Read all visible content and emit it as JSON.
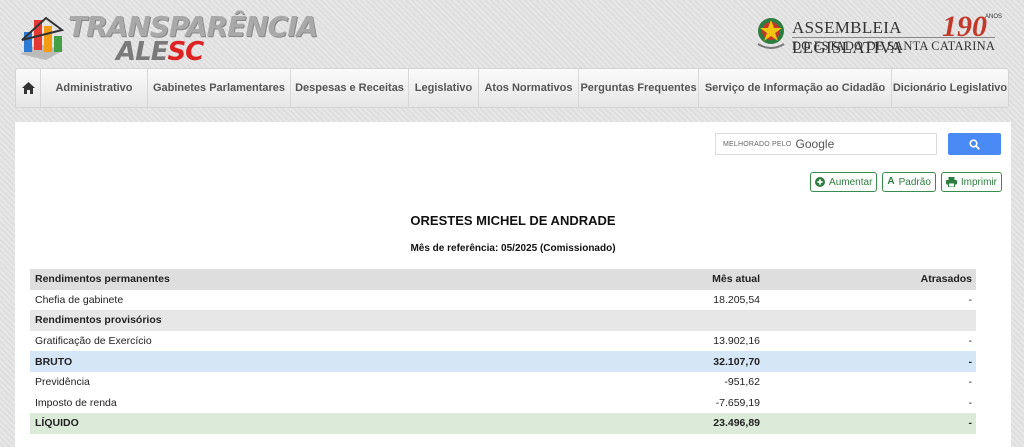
{
  "header": {
    "logo_line1": "TRANSPARÊNCIA",
    "logo_line2_prefix": "ALE",
    "logo_line2_suffix": "SC",
    "org_line1": "ASSEMBLEIA LEGISLATIVA",
    "org_line2": "DO ESTADO DE SANTA CATARINA",
    "anniversary": "190",
    "anniversary_small": "ANOS"
  },
  "nav": {
    "home_icon": "home-icon",
    "items": [
      "Administrativo",
      "Gabinetes Parlamentares",
      "Despesas e Receitas",
      "Legislativo",
      "Atos Normativos",
      "Perguntas Frequentes",
      "Serviço de Informação ao Cidadão",
      "Dicionário Legislativo"
    ]
  },
  "search": {
    "enhanced_label": "MELHORADO PELO",
    "brand": "Google",
    "button_icon": "search-icon"
  },
  "toolbar": {
    "increase": "Aumentar",
    "default": "Padrão",
    "print": "Imprimir"
  },
  "page": {
    "name": "ORESTES MICHEL DE ANDRADE",
    "reference": "Mês de referência: 05/2025 (Comissionado)"
  },
  "table": {
    "headers": [
      "Rendimentos permanentes",
      "Mês atual",
      "Atrasados"
    ],
    "rows": [
      {
        "label": "Chefia de gabinete",
        "current": "18.205,54",
        "late": "-",
        "type": "item"
      },
      {
        "label": "Rendimentos provisórios",
        "current": "",
        "late": "",
        "type": "section"
      },
      {
        "label": "Gratificação de Exercício",
        "current": "13.902,16",
        "late": "-",
        "type": "item"
      },
      {
        "label": "BRUTO",
        "current": "32.107,70",
        "late": "-",
        "type": "bruto"
      },
      {
        "label": "Previdência",
        "current": "-951,62",
        "late": "-",
        "type": "item"
      },
      {
        "label": "Imposto de renda",
        "current": "-7.659,19",
        "late": "-",
        "type": "item"
      },
      {
        "label": "LÍQUIDO",
        "current": "23.496,89",
        "late": "-",
        "type": "liquido"
      }
    ]
  },
  "colors": {
    "accent_green": "#2e7d40",
    "search_blue": "#4a8af4",
    "bruto_bg": "#d5e6f7",
    "liquido_bg": "#dcebd9"
  }
}
